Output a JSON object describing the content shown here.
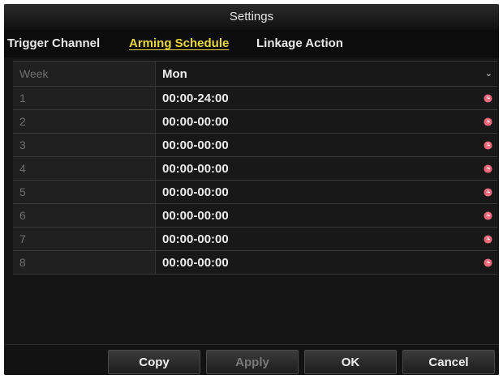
{
  "dialog": {
    "title": "Settings"
  },
  "tabs": [
    {
      "label": "Trigger Channel",
      "active": false
    },
    {
      "label": "Arming Schedule",
      "active": true
    },
    {
      "label": "Linkage Action",
      "active": false
    }
  ],
  "schedule": {
    "week_label": "Week",
    "week_value": "Mon",
    "rows": [
      {
        "index": "1",
        "time": "00:00-24:00"
      },
      {
        "index": "2",
        "time": "00:00-00:00"
      },
      {
        "index": "3",
        "time": "00:00-00:00"
      },
      {
        "index": "4",
        "time": "00:00-00:00"
      },
      {
        "index": "5",
        "time": "00:00-00:00"
      },
      {
        "index": "6",
        "time": "00:00-00:00"
      },
      {
        "index": "7",
        "time": "00:00-00:00"
      },
      {
        "index": "8",
        "time": "00:00-00:00"
      }
    ]
  },
  "buttons": {
    "copy": "Copy",
    "apply": "Apply",
    "ok": "OK",
    "cancel": "Cancel"
  },
  "colors": {
    "active_tab": "#e8d63a",
    "clock_icon": "#f06a7c"
  },
  "icons": {
    "time_picker": "clock-icon",
    "dropdown": "chevron-down-icon"
  }
}
